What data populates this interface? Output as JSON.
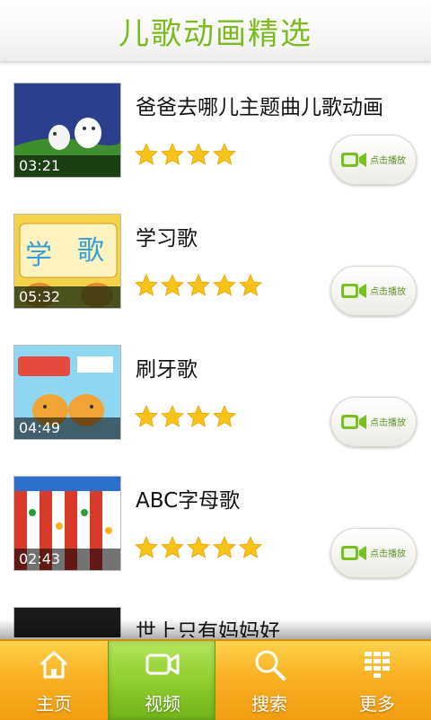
{
  "header": {
    "title": "儿歌动画精选"
  },
  "colors": {
    "accent": "#7cba1e",
    "star": "#f7c21a",
    "tabbar": "#f9b125",
    "tab_active": "#8fce2e"
  },
  "items": [
    {
      "title": "爸爸去哪儿主题曲儿歌动画",
      "duration": "03:21",
      "rating": 4,
      "play_label": "点击播放"
    },
    {
      "title": "学习歌",
      "duration": "05:32",
      "rating": 5,
      "play_label": "点击播放"
    },
    {
      "title": "刷牙歌",
      "duration": "04:49",
      "rating": 4,
      "play_label": "点击播放"
    },
    {
      "title": "ABC字母歌",
      "duration": "02:43",
      "rating": 5,
      "play_label": "点击播放"
    },
    {
      "title": "世上只有妈妈好",
      "duration": "",
      "rating": 0,
      "play_label": ""
    }
  ],
  "tabs": [
    {
      "label": "主页",
      "icon": "home-icon",
      "active": false
    },
    {
      "label": "视频",
      "icon": "video-camera-icon",
      "active": true
    },
    {
      "label": "搜索",
      "icon": "search-icon",
      "active": false
    },
    {
      "label": "更多",
      "icon": "more-grid-icon",
      "active": false
    }
  ]
}
